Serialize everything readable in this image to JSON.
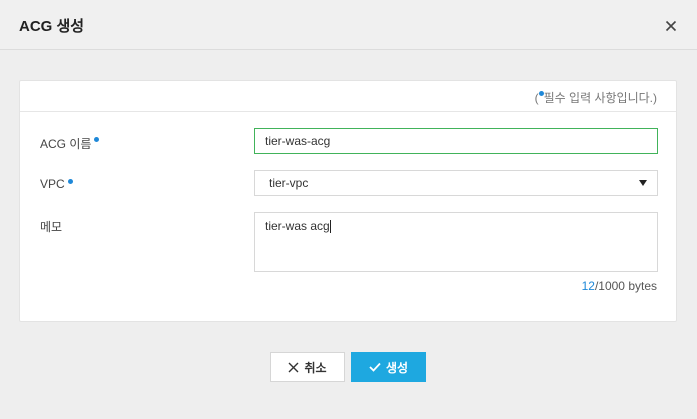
{
  "dialog": {
    "title": "ACG 생성"
  },
  "form": {
    "required_note_open": "(",
    "required_note_text": "필수 입력 사항입니다.)",
    "fields": {
      "name": {
        "label": "ACG 이름",
        "value": "tier-was-acg"
      },
      "vpc": {
        "label": "VPC",
        "value": "tier-vpc"
      },
      "memo": {
        "label": "메모",
        "value": "tier-was acg"
      }
    },
    "counter": {
      "current": "12",
      "max": "/1000 bytes"
    }
  },
  "buttons": {
    "cancel": "취소",
    "create": "생성"
  },
  "colors": {
    "accent": "#1ea8e0",
    "required_dot": "#1e88d8",
    "focus_border": "#41b35a"
  }
}
